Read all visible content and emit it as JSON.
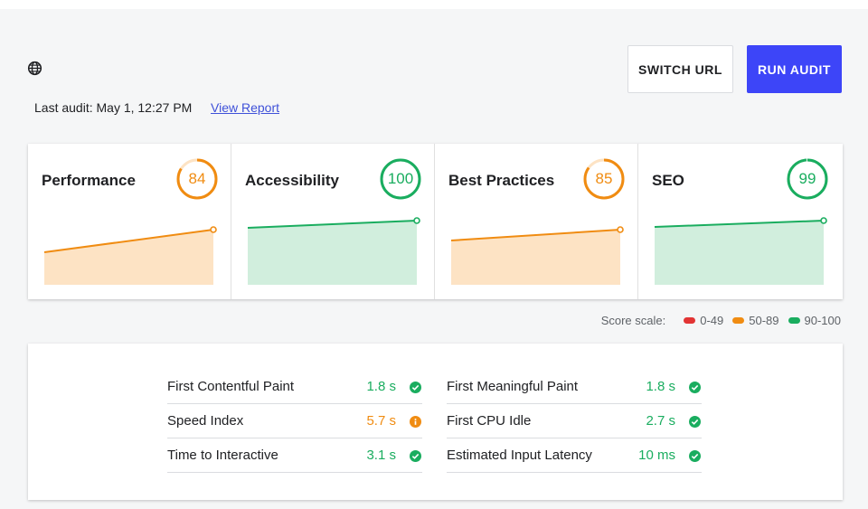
{
  "header": {
    "globe_icon": "globe-icon",
    "last_audit": "Last audit: May 1, 12:27 PM",
    "view_report": "View Report",
    "switch_url": "SWITCH URL",
    "run_audit": "RUN AUDIT"
  },
  "colors": {
    "orange": "#f08c12",
    "green": "#1aad5f",
    "red": "#e23434",
    "orange_fill": "#fde3c4",
    "green_fill": "#d1eedd",
    "primary": "#3d45f8"
  },
  "scores": [
    {
      "name": "Performance",
      "value": "84",
      "color": "orange",
      "fraction": 0.84
    },
    {
      "name": "Accessibility",
      "value": "100",
      "color": "green",
      "fraction": 1.0
    },
    {
      "name": "Best Practices",
      "value": "85",
      "color": "orange",
      "fraction": 0.85
    },
    {
      "name": "SEO",
      "value": "99",
      "color": "green",
      "fraction": 0.99
    }
  ],
  "score_scale": {
    "label": "Score scale:",
    "items": [
      {
        "range": "0-49",
        "color": "red"
      },
      {
        "range": "50-89",
        "color": "orange"
      },
      {
        "range": "90-100",
        "color": "green"
      }
    ]
  },
  "metrics": {
    "left": [
      {
        "name": "First Contentful Paint",
        "value": "1.8 s",
        "status": "green",
        "icon": "check-circle-icon"
      },
      {
        "name": "Speed Index",
        "value": "5.7 s",
        "status": "orange",
        "icon": "info-circle-icon"
      },
      {
        "name": "Time to Interactive",
        "value": "3.1 s",
        "status": "green",
        "icon": "check-circle-icon"
      }
    ],
    "right": [
      {
        "name": "First Meaningful Paint",
        "value": "1.8 s",
        "status": "green",
        "icon": "check-circle-icon"
      },
      {
        "name": "First CPU Idle",
        "value": "2.7 s",
        "status": "green",
        "icon": "check-circle-icon"
      },
      {
        "name": "Estimated Input Latency",
        "value": "10 ms",
        "status": "green",
        "icon": "check-circle-icon"
      }
    ]
  }
}
